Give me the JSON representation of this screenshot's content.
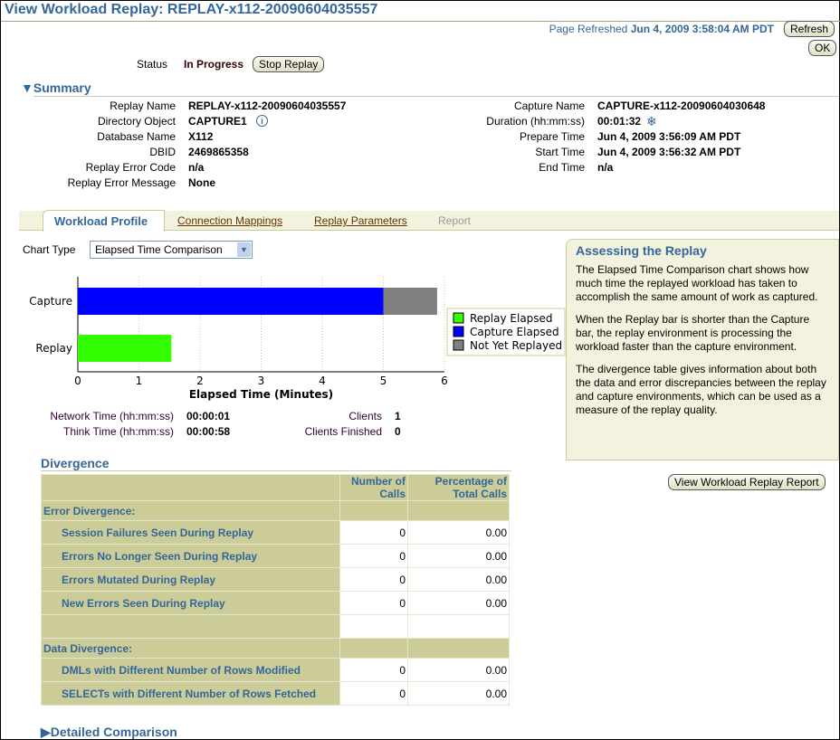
{
  "header": {
    "title": "View Workload Replay: REPLAY-x112-20090604035557",
    "refreshed_label": "Page Refreshed",
    "refreshed_value": "Jun 4, 2009 3:58:04 AM PDT",
    "refresh_button": "Refresh",
    "ok_button": "OK"
  },
  "status": {
    "label": "Status",
    "value": "In Progress",
    "stop_button": "Stop Replay"
  },
  "summary": {
    "title": "Summary",
    "left": [
      {
        "label": "Replay Name",
        "value": "REPLAY-x112-20090604035557"
      },
      {
        "label": "Directory Object",
        "value": "CAPTURE1"
      },
      {
        "label": "Database Name",
        "value": "X112"
      },
      {
        "label": "DBID",
        "value": "2469865358"
      },
      {
        "label": "Replay Error Code",
        "value": "n/a"
      },
      {
        "label": "Replay Error Message",
        "value": "None"
      }
    ],
    "right": [
      {
        "label": "Capture Name",
        "value": "CAPTURE-x112-20090604030648"
      },
      {
        "label": "Duration (hh:mm:ss)",
        "value": "00:01:32"
      },
      {
        "label": "Prepare Time",
        "value": "Jun 4, 2009 3:56:09 AM PDT"
      },
      {
        "label": "Start Time",
        "value": "Jun 4, 2009 3:56:32 AM PDT"
      },
      {
        "label": "End Time",
        "value": "n/a"
      }
    ]
  },
  "tabs": [
    {
      "label": "Workload Profile",
      "active": true
    },
    {
      "label": "Connection Mappings"
    },
    {
      "label": "Replay Parameters"
    },
    {
      "label": "Report",
      "disabled": true
    }
  ],
  "chart_type": {
    "label": "Chart Type",
    "value": "Elapsed Time Comparison"
  },
  "chart_data": {
    "type": "bar",
    "orientation": "horizontal",
    "stacked": true,
    "categories": [
      "Capture",
      "Replay"
    ],
    "xlabel": "Elapsed Time (Minutes)",
    "xlim": [
      0,
      6
    ],
    "xticks": [
      "0",
      "1",
      "2",
      "3",
      "4",
      "5",
      "6"
    ],
    "grid": true,
    "legend_placement": "right",
    "series": [
      {
        "name": "Replay Elapsed",
        "color": "#33ff00",
        "values": [
          0,
          1.53
        ]
      },
      {
        "name": "Capture Elapsed",
        "color": "#0000ff",
        "values": [
          5.0,
          0
        ]
      },
      {
        "name": "Not Yet Replayed",
        "color": "#808080",
        "values": [
          0.88,
          0
        ]
      }
    ]
  },
  "stats": [
    {
      "label": "Network Time (hh:mm:ss)",
      "value": "00:00:01"
    },
    {
      "label": "Think Time (hh:mm:ss)",
      "value": "00:00:58"
    },
    {
      "label": "Clients",
      "value": "1"
    },
    {
      "label": "Clients Finished",
      "value": "0"
    }
  ],
  "help": {
    "title": "Assessing the Replay",
    "paragraphs": [
      "The Elapsed Time Comparison chart shows how much time the replayed workload has taken to accomplish the same amount of work as captured.",
      "When the Replay bar is shorter than the Capture bar, the replay environment is processing the workload faster than the capture environment.",
      "The divergence table gives information about both the data and error discrepancies between the replay and capture environments, which can be used as a measure of the replay quality."
    ]
  },
  "report_button": "View Workload Replay Report",
  "divergence": {
    "title": "Divergence",
    "col1": "Number of Calls",
    "col2": "Percentage of Total Calls",
    "error_title": "Error Divergence:",
    "error_rows": [
      {
        "label": "Session Failures Seen During Replay",
        "calls": "0",
        "pct": "0.00"
      },
      {
        "label": "Errors No Longer Seen During Replay",
        "calls": "0",
        "pct": "0.00"
      },
      {
        "label": "Errors Mutated During Replay",
        "calls": "0",
        "pct": "0.00"
      },
      {
        "label": "New Errors Seen During Replay",
        "calls": "0",
        "pct": "0.00"
      }
    ],
    "data_title": "Data Divergence:",
    "data_rows": [
      {
        "label": "DMLs with Different Number of Rows Modified",
        "calls": "0",
        "pct": "0.00"
      },
      {
        "label": "SELECTs with Different Number of Rows Fetched",
        "calls": "0",
        "pct": "0.00"
      }
    ]
  },
  "detailed": {
    "title": "Detailed Comparison"
  }
}
